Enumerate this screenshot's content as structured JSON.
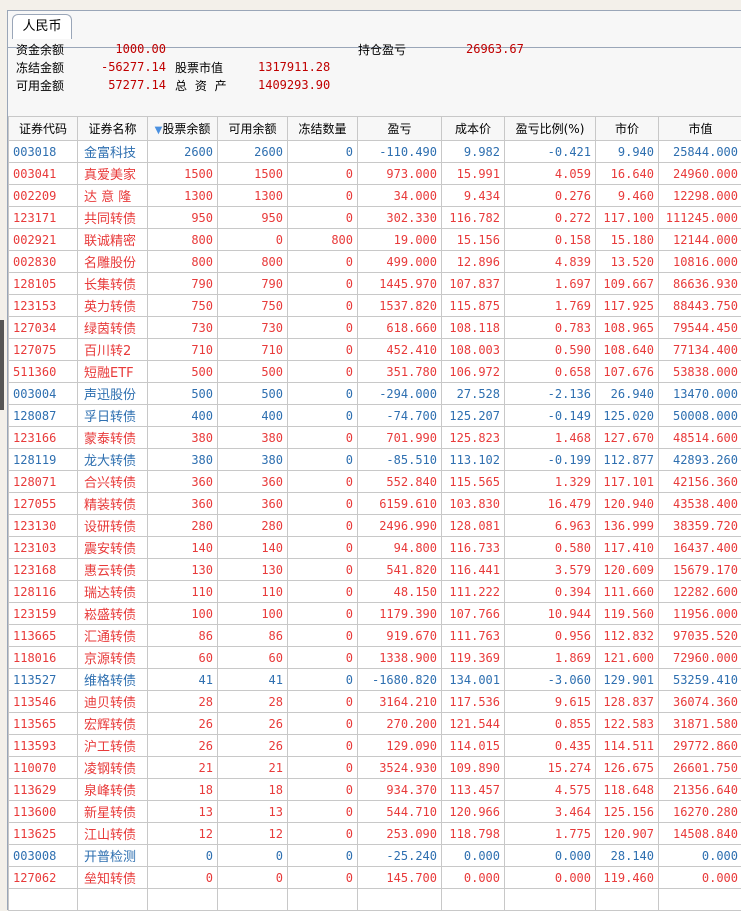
{
  "tab_label": "人民币",
  "summary": {
    "fund_balance_label": "资金余额",
    "fund_balance": "1000.00",
    "frozen_amount_label": "冻结金额",
    "frozen_amount": "-56277.14",
    "available_amount_label": "可用金额",
    "available_amount": "57277.14",
    "stock_value_label": "股票市值",
    "stock_value": "1317911.28",
    "total_assets_label": "总 资 产",
    "total_assets": "1409293.90",
    "position_pnl_label": "持仓盈亏",
    "position_pnl": "26963.67"
  },
  "colors": {
    "up": "#e83a3a",
    "down": "#2e6fb0",
    "value": "#c00000"
  },
  "columns": [
    "证券代码",
    "证券名称",
    "股票余额",
    "可用余额",
    "冻结数量",
    "盈亏",
    "成本价",
    "盈亏比例(%)",
    "市价",
    "市值"
  ],
  "sort_icon": "triangle-down",
  "rows": [
    {
      "dir": "down",
      "cells": [
        "003018",
        "金富科技",
        "2600",
        "2600",
        "0",
        "-110.490",
        "9.982",
        "-0.421",
        "9.940",
        "25844.000"
      ]
    },
    {
      "dir": "up",
      "cells": [
        "003041",
        "真爱美家",
        "1500",
        "1500",
        "0",
        "973.000",
        "15.991",
        "4.059",
        "16.640",
        "24960.000"
      ]
    },
    {
      "dir": "up",
      "cells": [
        "002209",
        "达 意 隆",
        "1300",
        "1300",
        "0",
        "34.000",
        "9.434",
        "0.276",
        "9.460",
        "12298.000"
      ]
    },
    {
      "dir": "up",
      "cells": [
        "123171",
        "共同转债",
        "950",
        "950",
        "0",
        "302.330",
        "116.782",
        "0.272",
        "117.100",
        "111245.000"
      ]
    },
    {
      "dir": "up",
      "cells": [
        "002921",
        "联诚精密",
        "800",
        "0",
        "800",
        "19.000",
        "15.156",
        "0.158",
        "15.180",
        "12144.000"
      ]
    },
    {
      "dir": "up",
      "cells": [
        "002830",
        "名雕股份",
        "800",
        "800",
        "0",
        "499.000",
        "12.896",
        "4.839",
        "13.520",
        "10816.000"
      ]
    },
    {
      "dir": "up",
      "cells": [
        "128105",
        "长集转债",
        "790",
        "790",
        "0",
        "1445.970",
        "107.837",
        "1.697",
        "109.667",
        "86636.930"
      ]
    },
    {
      "dir": "up",
      "cells": [
        "123153",
        "英力转债",
        "750",
        "750",
        "0",
        "1537.820",
        "115.875",
        "1.769",
        "117.925",
        "88443.750"
      ]
    },
    {
      "dir": "up",
      "cells": [
        "127034",
        "绿茵转债",
        "730",
        "730",
        "0",
        "618.660",
        "108.118",
        "0.783",
        "108.965",
        "79544.450"
      ]
    },
    {
      "dir": "up",
      "cells": [
        "127075",
        "百川转2",
        "710",
        "710",
        "0",
        "452.410",
        "108.003",
        "0.590",
        "108.640",
        "77134.400"
      ]
    },
    {
      "dir": "up",
      "cells": [
        "511360",
        "短融ETF",
        "500",
        "500",
        "0",
        "351.780",
        "106.972",
        "0.658",
        "107.676",
        "53838.000"
      ]
    },
    {
      "dir": "down",
      "cells": [
        "003004",
        "声迅股份",
        "500",
        "500",
        "0",
        "-294.000",
        "27.528",
        "-2.136",
        "26.940",
        "13470.000"
      ]
    },
    {
      "dir": "down",
      "cells": [
        "128087",
        "孚日转债",
        "400",
        "400",
        "0",
        "-74.700",
        "125.207",
        "-0.149",
        "125.020",
        "50008.000"
      ]
    },
    {
      "dir": "up",
      "cells": [
        "123166",
        "蒙泰转债",
        "380",
        "380",
        "0",
        "701.990",
        "125.823",
        "1.468",
        "127.670",
        "48514.600"
      ]
    },
    {
      "dir": "down",
      "cells": [
        "128119",
        "龙大转债",
        "380",
        "380",
        "0",
        "-85.510",
        "113.102",
        "-0.199",
        "112.877",
        "42893.260"
      ]
    },
    {
      "dir": "up",
      "cells": [
        "128071",
        "合兴转债",
        "360",
        "360",
        "0",
        "552.840",
        "115.565",
        "1.329",
        "117.101",
        "42156.360"
      ]
    },
    {
      "dir": "up",
      "cells": [
        "127055",
        "精装转债",
        "360",
        "360",
        "0",
        "6159.610",
        "103.830",
        "16.479",
        "120.940",
        "43538.400"
      ]
    },
    {
      "dir": "up",
      "cells": [
        "123130",
        "设研转债",
        "280",
        "280",
        "0",
        "2496.990",
        "128.081",
        "6.963",
        "136.999",
        "38359.720"
      ]
    },
    {
      "dir": "up",
      "cells": [
        "123103",
        "震安转债",
        "140",
        "140",
        "0",
        "94.800",
        "116.733",
        "0.580",
        "117.410",
        "16437.400"
      ]
    },
    {
      "dir": "up",
      "cells": [
        "123168",
        "惠云转债",
        "130",
        "130",
        "0",
        "541.820",
        "116.441",
        "3.579",
        "120.609",
        "15679.170"
      ]
    },
    {
      "dir": "up",
      "cells": [
        "128116",
        "瑞达转债",
        "110",
        "110",
        "0",
        "48.150",
        "111.222",
        "0.394",
        "111.660",
        "12282.600"
      ]
    },
    {
      "dir": "up",
      "cells": [
        "123159",
        "崧盛转债",
        "100",
        "100",
        "0",
        "1179.390",
        "107.766",
        "10.944",
        "119.560",
        "11956.000"
      ]
    },
    {
      "dir": "up",
      "cells": [
        "113665",
        "汇通转债",
        "86",
        "86",
        "0",
        "919.670",
        "111.763",
        "0.956",
        "112.832",
        "97035.520"
      ]
    },
    {
      "dir": "up",
      "cells": [
        "118016",
        "京源转债",
        "60",
        "60",
        "0",
        "1338.900",
        "119.369",
        "1.869",
        "121.600",
        "72960.000"
      ]
    },
    {
      "dir": "down",
      "cells": [
        "113527",
        "维格转债",
        "41",
        "41",
        "0",
        "-1680.820",
        "134.001",
        "-3.060",
        "129.901",
        "53259.410"
      ]
    },
    {
      "dir": "up",
      "cells": [
        "113546",
        "迪贝转债",
        "28",
        "28",
        "0",
        "3164.210",
        "117.536",
        "9.615",
        "128.837",
        "36074.360"
      ]
    },
    {
      "dir": "up",
      "cells": [
        "113565",
        "宏辉转债",
        "26",
        "26",
        "0",
        "270.200",
        "121.544",
        "0.855",
        "122.583",
        "31871.580"
      ]
    },
    {
      "dir": "up",
      "cells": [
        "113593",
        "沪工转债",
        "26",
        "26",
        "0",
        "129.090",
        "114.015",
        "0.435",
        "114.511",
        "29772.860"
      ]
    },
    {
      "dir": "up",
      "cells": [
        "110070",
        "凌钢转债",
        "21",
        "21",
        "0",
        "3524.930",
        "109.890",
        "15.274",
        "126.675",
        "26601.750"
      ]
    },
    {
      "dir": "up",
      "cells": [
        "113629",
        "泉峰转债",
        "18",
        "18",
        "0",
        "934.370",
        "113.457",
        "4.575",
        "118.648",
        "21356.640"
      ]
    },
    {
      "dir": "up",
      "cells": [
        "113600",
        "新星转债",
        "13",
        "13",
        "0",
        "544.710",
        "120.966",
        "3.464",
        "125.156",
        "16270.280"
      ]
    },
    {
      "dir": "up",
      "cells": [
        "113625",
        "江山转债",
        "12",
        "12",
        "0",
        "253.090",
        "118.798",
        "1.775",
        "120.907",
        "14508.840"
      ]
    },
    {
      "dir": "down",
      "cells": [
        "003008",
        "开普检测",
        "0",
        "0",
        "0",
        "-25.240",
        "0.000",
        "0.000",
        "28.140",
        "0.000"
      ]
    },
    {
      "dir": "up",
      "cells": [
        "127062",
        "垒知转债",
        "0",
        "0",
        "0",
        "145.700",
        "0.000",
        "0.000",
        "119.460",
        "0.000"
      ]
    }
  ]
}
